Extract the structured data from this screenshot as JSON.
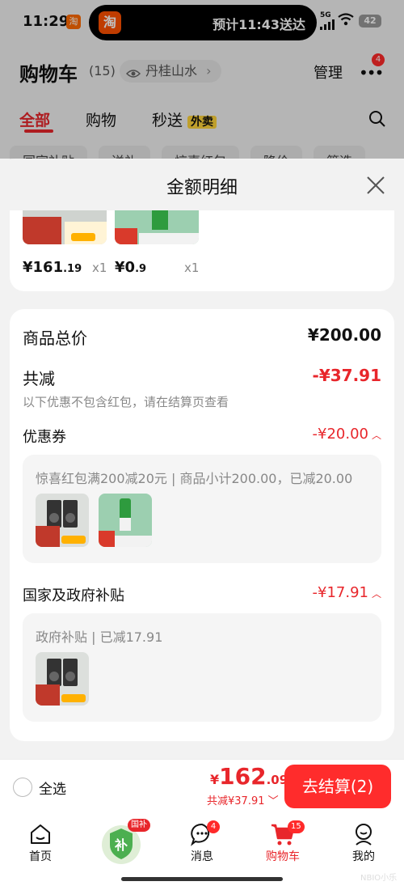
{
  "status": {
    "time": "11:29",
    "app_badge": "淘",
    "island_icon": "淘",
    "island_text": "预计11:43送达",
    "network": "5G",
    "battery": "42"
  },
  "header": {
    "title": "购物车",
    "count": "(15)",
    "address": "丹桂山水",
    "manage": "管理",
    "more_badge": "4"
  },
  "tabs": [
    {
      "label": "全部"
    },
    {
      "label": "购物"
    },
    {
      "label": "秒送",
      "tag": "外卖"
    }
  ],
  "chips": [
    "国家补贴",
    "送礼",
    "惊喜红包",
    "降价",
    "筛选"
  ],
  "sheet": {
    "title": "金额明细",
    "products": [
      {
        "price_main": "¥161",
        "price_dec": ".19",
        "qty": "x1"
      },
      {
        "price_main": "¥0",
        "price_dec": ".9",
        "qty": "x1"
      }
    ],
    "total_label": "商品总价",
    "total_value": "¥200.00",
    "saving_label": "共减",
    "saving_value": "-¥37.91",
    "saving_note": "以下优惠不包含红包，请在结算页查看",
    "coupon_label": "优惠券",
    "coupon_value": "-¥20.00",
    "coupon_detail": "惊喜红包满200减20元 | 商品小计200.00，已减20.00",
    "subsidy_label": "国家及政府补贴",
    "subsidy_value": "-¥17.91",
    "subsidy_detail": "政府补贴 | 已减17.91"
  },
  "checkout": {
    "select_all": "全选",
    "yen": "¥",
    "total_int": "162",
    "total_dec": ".09",
    "discount": "共减¥37.91",
    "button": "去结算(2)"
  },
  "tabbar": {
    "items": [
      {
        "label": "首页"
      },
      {
        "label": "国补",
        "badge": "国补"
      },
      {
        "label": "消息",
        "badge": "4"
      },
      {
        "label": "购物车",
        "badge": "15"
      },
      {
        "label": "我的"
      }
    ]
  },
  "watermark": "NBIO小乐"
}
